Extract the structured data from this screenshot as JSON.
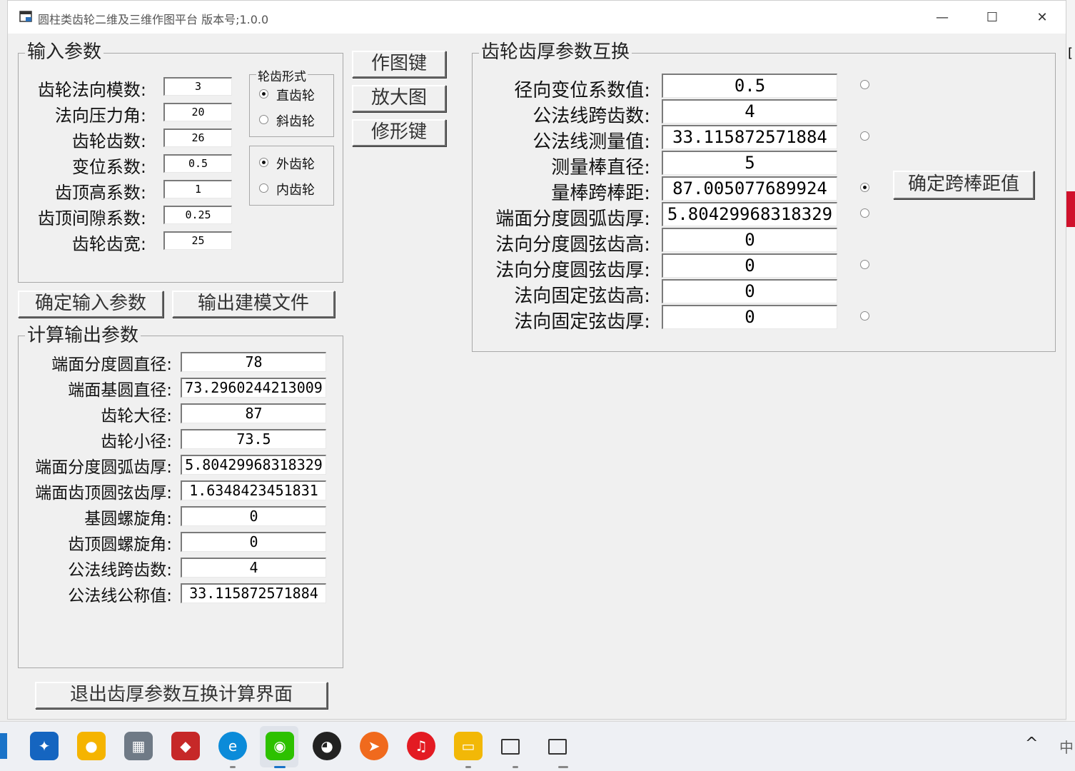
{
  "window": {
    "title": "圆柱类齿轮二维及三维作图平台 版本号;1.0.0",
    "minimize": "—",
    "maximize": "☐",
    "close": "✕"
  },
  "input_group": {
    "title": "输入参数",
    "fields": [
      {
        "label": "齿轮法向模数:",
        "value": "3"
      },
      {
        "label": "法向压力角:",
        "value": "20"
      },
      {
        "label": "齿轮齿数:",
        "value": "26"
      },
      {
        "label": "变位系数:",
        "value": "0.5"
      },
      {
        "label": "齿顶高系数:",
        "value": "1"
      },
      {
        "label": "齿顶间隙系数:",
        "value": "0.25"
      },
      {
        "label": "齿轮齿宽:",
        "value": "25"
      }
    ],
    "tooth_form": {
      "title": "轮齿形式",
      "opt1": "直齿轮",
      "opt2": "斜齿轮"
    },
    "gear_type": {
      "opt1": "外齿轮",
      "opt2": "内齿轮"
    }
  },
  "buttons": {
    "plot": "作图键",
    "zoom": "放大图",
    "modify": "修形键",
    "confirm_input": "确定输入参数",
    "export_model": "输出建模文件",
    "confirm_span": "确定跨棒距值",
    "exit": "退出齿厚参数互换计算界面"
  },
  "output_group": {
    "title": "计算输出参数",
    "fields": [
      {
        "label": "端面分度圆直径:",
        "value": "78"
      },
      {
        "label": "端面基圆直径:",
        "value": "73.2960244213009"
      },
      {
        "label": "齿轮大径:",
        "value": "87"
      },
      {
        "label": "齿轮小径:",
        "value": "73.5"
      },
      {
        "label": "端面分度圆弧齿厚:",
        "value": "5.80429968318329"
      },
      {
        "label": "端面齿顶圆弦齿厚:",
        "value": "1.6348423451831"
      },
      {
        "label": "基圆螺旋角:",
        "value": "0"
      },
      {
        "label": "齿顶圆螺旋角:",
        "value": "0"
      },
      {
        "label": "公法线跨齿数:",
        "value": "4"
      },
      {
        "label": "公法线公称值:",
        "value": "33.115872571884"
      }
    ]
  },
  "exchange_group": {
    "title": "齿轮齿厚参数互换",
    "fields": [
      {
        "label": "径向变位系数值:",
        "value": "0.5"
      },
      {
        "label": "公法线跨齿数:",
        "value": "4"
      },
      {
        "label": "公法线测量值:",
        "value": "33.115872571884"
      },
      {
        "label": "测量棒直径:",
        "value": "5"
      },
      {
        "label": "量棒跨棒距:",
        "value": "87.005077689924"
      },
      {
        "label": "端面分度圆弧齿厚:",
        "value": "5.80429968318329"
      },
      {
        "label": "法向分度圆弦齿高:",
        "value": "0"
      },
      {
        "label": "法向分度圆弦齿厚:",
        "value": "0"
      },
      {
        "label": "法向固定弦齿高:",
        "value": "0"
      },
      {
        "label": "法向固定弦齿厚:",
        "value": "0"
      }
    ]
  },
  "taskbar": {
    "icons": [
      "app-icon",
      "paint-icon",
      "calculator-icon",
      "browser-icon",
      "edge-icon",
      "wechat-icon",
      "qq-icon",
      "game-icon",
      "netease-music-icon",
      "file-explorer-icon",
      "window-app-icon",
      "window-app-icon"
    ],
    "chevron": "^",
    "ime": "中"
  },
  "colors": {
    "accent": "#1a73c8",
    "window_bg": "#f0f0f0"
  }
}
